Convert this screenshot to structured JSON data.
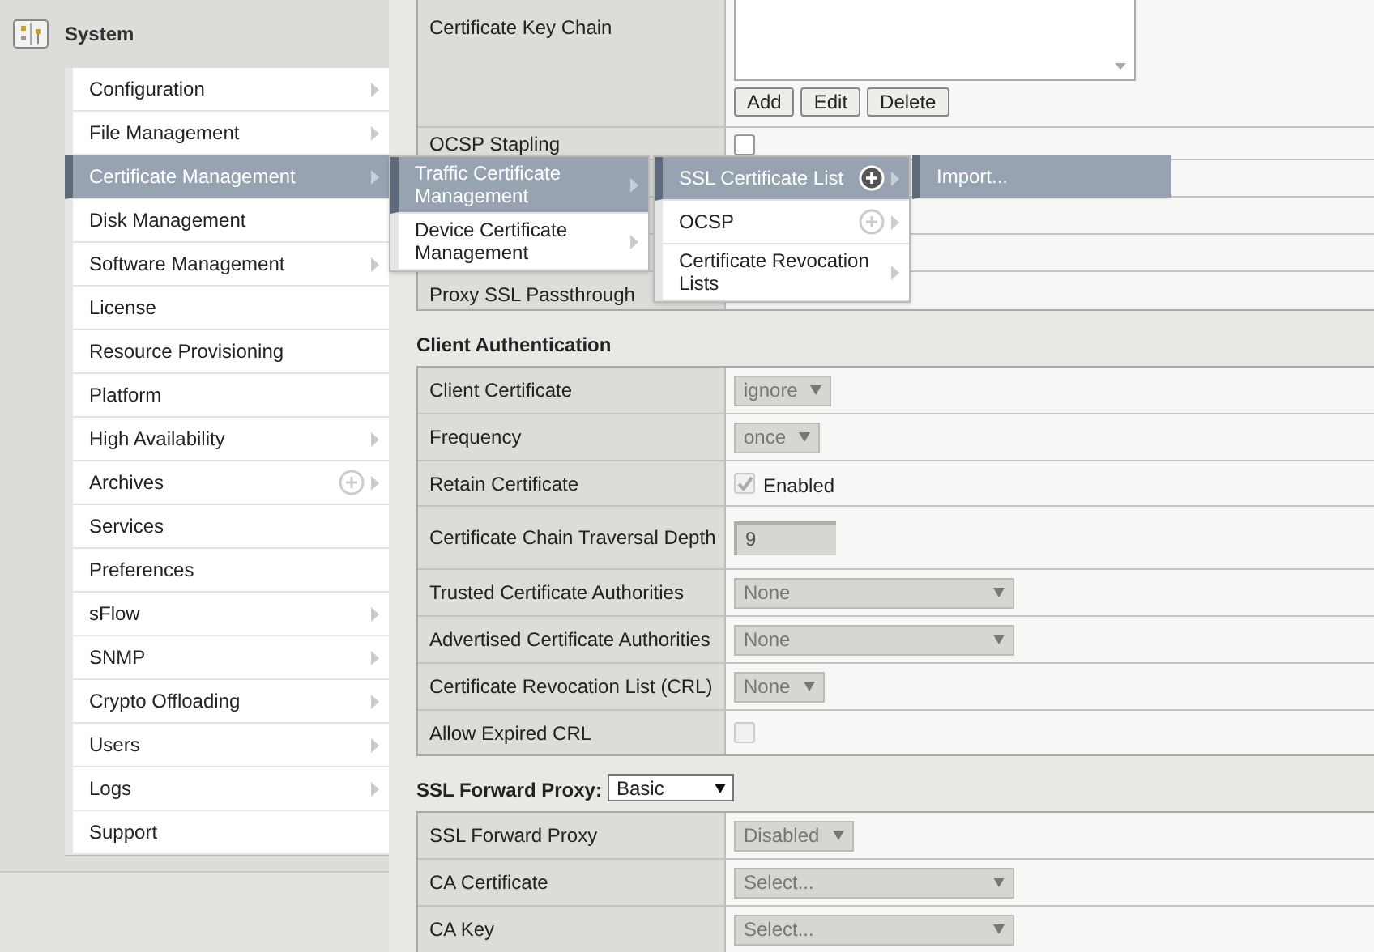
{
  "sidebar": {
    "title": "System",
    "menu": [
      {
        "label": "Configuration",
        "selected": false,
        "submenu": true,
        "addable": false
      },
      {
        "label": "File Management",
        "selected": false,
        "submenu": true,
        "addable": false
      },
      {
        "label": "Certificate Management",
        "selected": true,
        "submenu": true,
        "addable": false
      },
      {
        "label": "Disk Management",
        "selected": false,
        "submenu": false,
        "addable": false
      },
      {
        "label": "Software Management",
        "selected": false,
        "submenu": true,
        "addable": false
      },
      {
        "label": "License",
        "selected": false,
        "submenu": false,
        "addable": false
      },
      {
        "label": "Resource Provisioning",
        "selected": false,
        "submenu": false,
        "addable": false
      },
      {
        "label": "Platform",
        "selected": false,
        "submenu": false,
        "addable": false
      },
      {
        "label": "High Availability",
        "selected": false,
        "submenu": true,
        "addable": false
      },
      {
        "label": "Archives",
        "selected": false,
        "submenu": true,
        "addable": true
      },
      {
        "label": "Services",
        "selected": false,
        "submenu": false,
        "addable": false
      },
      {
        "label": "Preferences",
        "selected": false,
        "submenu": false,
        "addable": false
      },
      {
        "label": "sFlow",
        "selected": false,
        "submenu": true,
        "addable": false
      },
      {
        "label": "SNMP",
        "selected": false,
        "submenu": true,
        "addable": false
      },
      {
        "label": "Crypto Offloading",
        "selected": false,
        "submenu": true,
        "addable": false
      },
      {
        "label": "Users",
        "selected": false,
        "submenu": true,
        "addable": false
      },
      {
        "label": "Logs",
        "selected": false,
        "submenu": true,
        "addable": false
      },
      {
        "label": "Support",
        "selected": false,
        "submenu": false,
        "addable": false
      }
    ]
  },
  "submenus": [
    {
      "items": [
        {
          "label": "Traffic Certificate Management",
          "selected": true,
          "submenu": true,
          "addable": false
        },
        {
          "label": "Device Certificate Management",
          "selected": false,
          "submenu": true,
          "addable": false
        }
      ]
    },
    {
      "items": [
        {
          "label": "SSL Certificate List",
          "selected": true,
          "submenu": true,
          "addable": true
        },
        {
          "label": "OCSP",
          "selected": false,
          "submenu": true,
          "addable": true
        },
        {
          "label": "Certificate Revocation Lists",
          "selected": false,
          "submenu": true,
          "addable": false
        }
      ]
    },
    {
      "items": [
        {
          "label": "Import...",
          "selected": true,
          "submenu": false,
          "addable": false
        }
      ]
    }
  ],
  "form": {
    "top_rows": [
      {
        "kind": "key_chain",
        "label": "Certificate Key Chain",
        "buttons": [
          "Add",
          "Edit",
          "Delete"
        ]
      },
      {
        "kind": "checkbox",
        "label": "OCSP Stapling",
        "checked": false,
        "disabled": false
      },
      {
        "kind": "label_only",
        "label": "Proxy SSL Passthrough"
      }
    ],
    "sections": [
      {
        "title": "Client Authentication",
        "rows": [
          {
            "kind": "select",
            "label": "Client Certificate",
            "value": "ignore",
            "wide": false
          },
          {
            "kind": "select",
            "label": "Frequency",
            "value": "once",
            "wide": false
          },
          {
            "kind": "checkbox",
            "label": "Retain Certificate",
            "checked": true,
            "disabled": true,
            "text": "Enabled"
          },
          {
            "kind": "text_input",
            "label": "Certificate Chain Traversal Depth",
            "value": "9"
          },
          {
            "kind": "select",
            "label": "Trusted Certificate Authorities",
            "value": "None",
            "wide": true
          },
          {
            "kind": "select",
            "label": "Advertised Certificate Authorities",
            "value": "None",
            "wide": true
          },
          {
            "kind": "select",
            "label": "Certificate Revocation List (CRL)",
            "value": "None",
            "wide": false
          },
          {
            "kind": "checkbox",
            "label": "Allow Expired CRL",
            "checked": false,
            "disabled": true
          }
        ]
      },
      {
        "title": "SSL Forward Proxy:",
        "mode": "Basic",
        "rows": [
          {
            "kind": "select",
            "label": "SSL Forward Proxy",
            "value": "Disabled",
            "wide": false
          },
          {
            "kind": "select",
            "label": "CA Certificate",
            "value": "Select...",
            "wide": true
          },
          {
            "kind": "select",
            "label": "CA Key",
            "value": "Select...",
            "wide": true
          }
        ]
      }
    ]
  }
}
